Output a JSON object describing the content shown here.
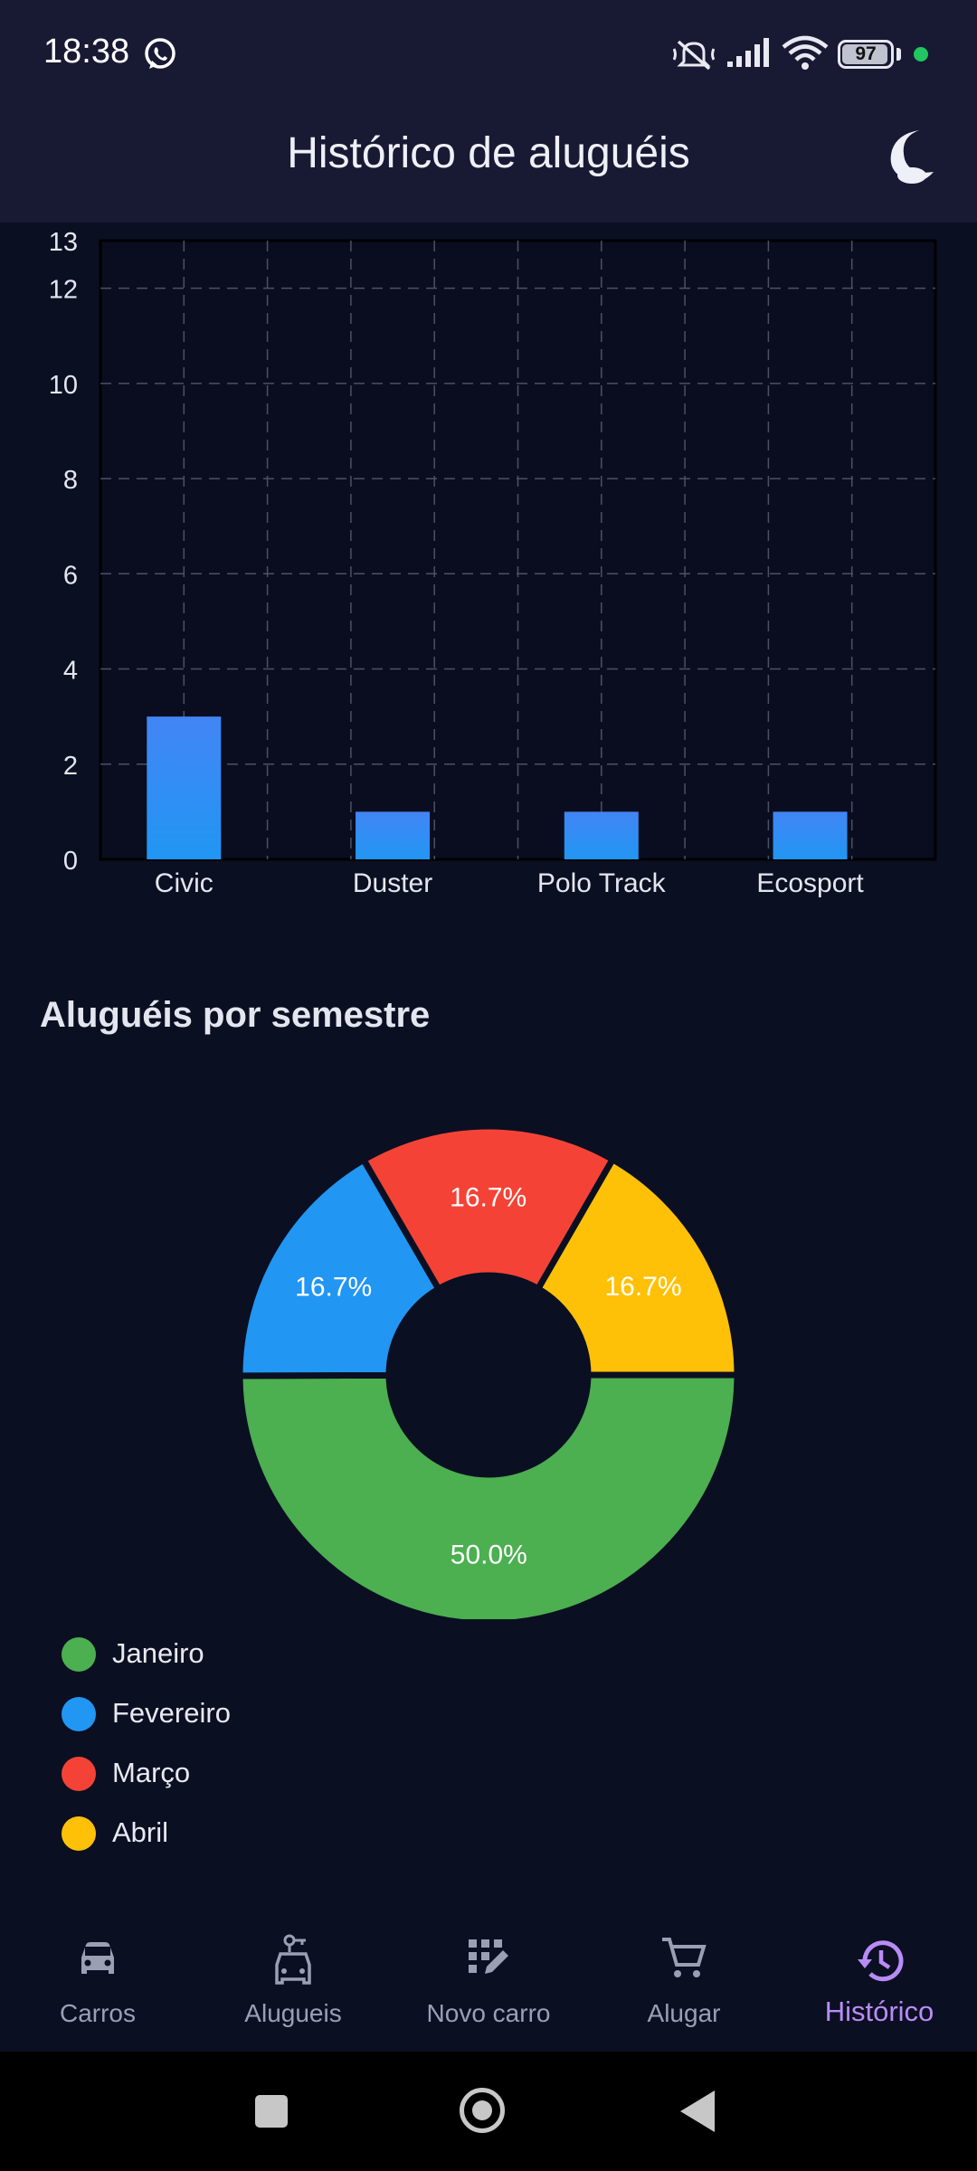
{
  "status_bar": {
    "time": "18:38",
    "battery": "97",
    "battery_level": 0.97,
    "icons": [
      "whatsapp-icon",
      "silent-mode-icon",
      "signal-icon",
      "wifi-icon",
      "battery-icon"
    ]
  },
  "app_bar": {
    "title": "Histórico de aluguéis",
    "theme_icon": "moon-icon"
  },
  "chart_data": [
    {
      "type": "bar",
      "title": "",
      "xlabel": "",
      "ylabel": "",
      "categories": [
        "Civic",
        "Duster",
        "Polo Track",
        "Ecosport"
      ],
      "values": [
        3,
        1,
        1,
        1
      ],
      "ylim": [
        0,
        13
      ],
      "y_ticks": [
        "0",
        "2",
        "4",
        "6",
        "8",
        "10",
        "12",
        "13"
      ],
      "grid": true,
      "bar_color": "#3b82f6"
    },
    {
      "type": "pie",
      "title": "Aluguéis por semestre",
      "labels": [
        "Janeiro",
        "Fevereiro",
        "Março",
        "Abril"
      ],
      "values": [
        50.0,
        16.7,
        16.7,
        16.7
      ],
      "value_labels": [
        "50.0%",
        "16.7%",
        "16.7%",
        "16.7%"
      ],
      "colors": [
        "#4caf50",
        "#2196f3",
        "#f44336",
        "#ffc107"
      ],
      "hole": true,
      "legend_position": "bottom-left"
    }
  ],
  "bottom_nav": {
    "items": [
      {
        "label": "Carros",
        "icon": "car-icon",
        "active": false
      },
      {
        "label": "Alugueis",
        "icon": "car-rental-icon",
        "active": false
      },
      {
        "label": "Novo carro",
        "icon": "edit-grid-icon",
        "active": false
      },
      {
        "label": "Alugar",
        "icon": "cart-icon",
        "active": false
      },
      {
        "label": "Histórico",
        "icon": "history-icon",
        "active": true
      }
    ],
    "active_color": "#b98cf5"
  },
  "system_nav": {
    "buttons": [
      "recents-button",
      "home-button",
      "back-button"
    ]
  }
}
